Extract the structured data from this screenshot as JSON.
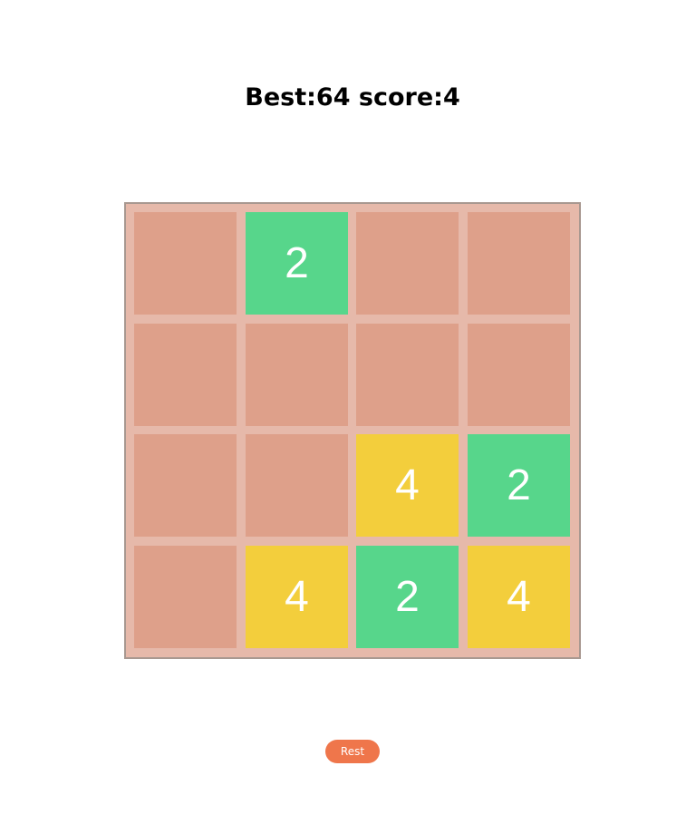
{
  "header": {
    "best_label": "Best:",
    "best_value": "64",
    "score_label": "score:",
    "score_value": "4"
  },
  "colors": {
    "empty": "#dea08a",
    "tile_2": "#57d68b",
    "tile_4": "#f3ce3c",
    "board_bg": "#e6b9aa",
    "button": "#ef764b"
  },
  "board": {
    "size": 4,
    "cells": [
      [
        0,
        2,
        0,
        0
      ],
      [
        0,
        0,
        0,
        0
      ],
      [
        0,
        0,
        4,
        2
      ],
      [
        0,
        4,
        2,
        4
      ]
    ]
  },
  "controls": {
    "reset_label": "Rest"
  }
}
